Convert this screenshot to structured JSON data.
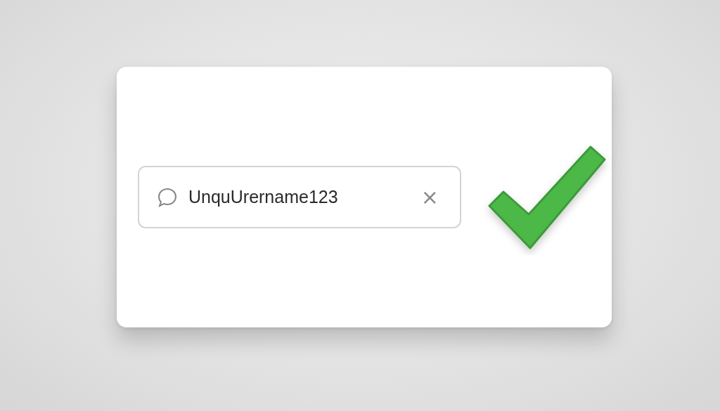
{
  "username_field": {
    "value": "UnquUrername123",
    "clear_label": "×",
    "valid": true
  }
}
